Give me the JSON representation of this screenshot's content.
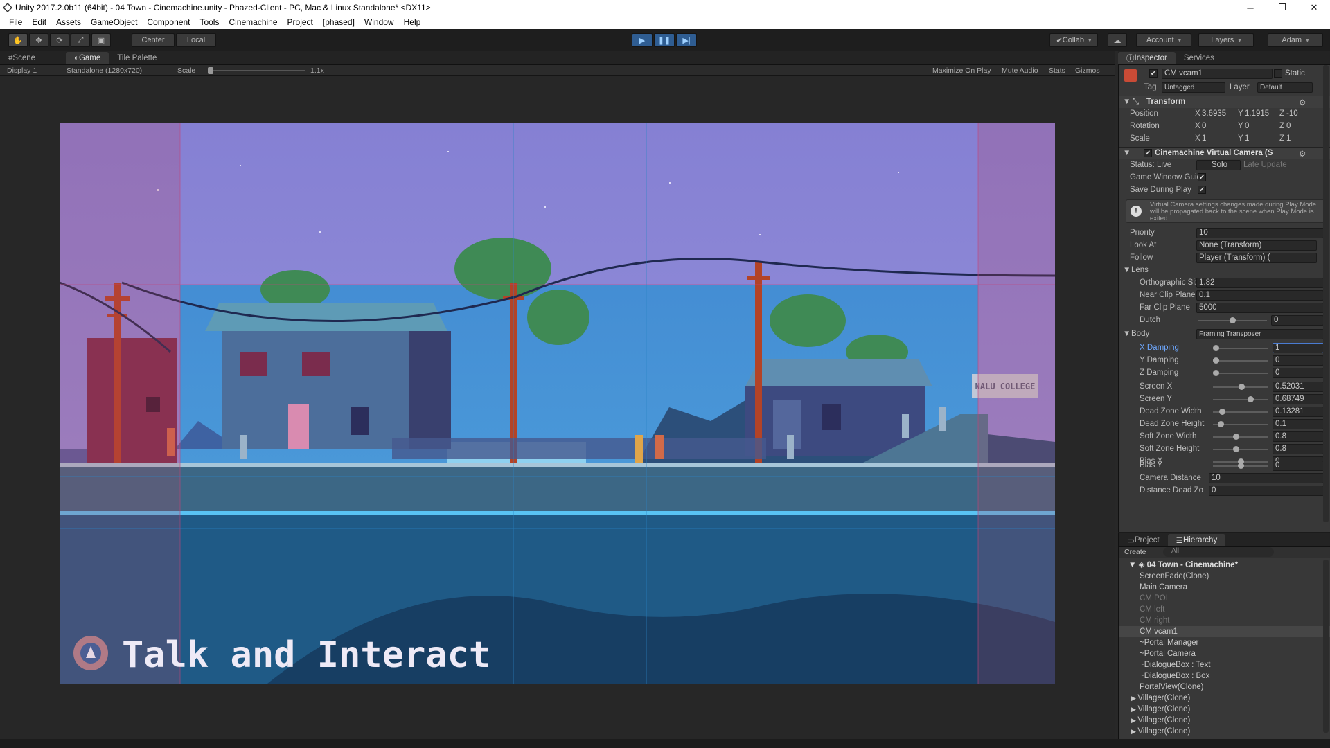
{
  "window": {
    "title": "Unity 2017.2.0b11 (64bit) - 04 Town - Cinemachine.unity - Phazed-Client - PC, Mac & Linux Standalone* <DX11>",
    "controls": [
      "─",
      "❐",
      "✕"
    ]
  },
  "menu": [
    "File",
    "Edit",
    "Assets",
    "GameObject",
    "Component",
    "Tools",
    "Cinemachine",
    "Project",
    "[phased]",
    "Window",
    "Help"
  ],
  "toolbar": {
    "pivot": "Center",
    "space": "Local",
    "collab": "Collab",
    "account": "Account",
    "layers": "Layers",
    "user": "Adam"
  },
  "tabs": {
    "scene": "Scene",
    "game": "Game",
    "tile_palette": "Tile Palette",
    "inspector": "Inspector",
    "services": "Services",
    "project": "Project",
    "hierarchy": "Hierarchy"
  },
  "gamebar": {
    "display": "Display 1",
    "resolution": "Standalone (1280x720)",
    "scale_label": "Scale",
    "scale_value": "1.1x",
    "maximize": "Maximize On Play",
    "mute": "Mute Audio",
    "stats": "Stats",
    "gizmos": "Gizmos"
  },
  "game": {
    "sign": "NALU COLLEGE",
    "overlay_text": "Talk and Interact",
    "colors": {
      "sky": "#8a86d6",
      "water": "#1e5a86",
      "ground": "#3d6f8a"
    }
  },
  "inspector": {
    "object_name": "CM vcam1",
    "static_label": "Static",
    "tag_label": "Tag",
    "tag_value": "Untagged",
    "layer_label": "Layer",
    "layer_value": "Default",
    "transform": {
      "title": "Transform",
      "position": {
        "label": "Position",
        "x": "3.6935",
        "y": "1.1915",
        "z": "-10"
      },
      "rotation": {
        "label": "Rotation",
        "x": "0",
        "y": "0",
        "z": "0"
      },
      "scale": {
        "label": "Scale",
        "x": "1",
        "y": "1",
        "z": "1"
      }
    },
    "vcam": {
      "title": "Cinemachine Virtual Camera (S",
      "status": "Status: Live",
      "solo": "Solo",
      "late_update": "Late Update",
      "game_window_guides": "Game Window Guide",
      "save_during_play": "Save During Play",
      "note": "Virtual Camera settings changes made during Play Mode will be propagated back to the scene when Play Mode is exited.",
      "priority": {
        "label": "Priority",
        "value": "10"
      },
      "look_at": {
        "label": "Look At",
        "value": "None (Transform)"
      },
      "follow": {
        "label": "Follow",
        "value": "Player (Transform) ("
      },
      "lens": "Lens",
      "ortho": {
        "label": "Orthographic Size",
        "value": "1.82"
      },
      "near": {
        "label": "Near Clip Plane",
        "value": "0.1"
      },
      "far": {
        "label": "Far Clip Plane",
        "value": "5000"
      },
      "dutch": {
        "label": "Dutch",
        "value": "0"
      },
      "body": {
        "label": "Body",
        "value": "Framing Transposer"
      },
      "sliders": [
        {
          "label": "X Damping",
          "value": "1",
          "level": 0.0,
          "highlight": true
        },
        {
          "label": "Y Damping",
          "value": "0",
          "level": 0.0
        },
        {
          "label": "Z Damping",
          "value": "0",
          "level": 0.0
        },
        {
          "label": "Screen X",
          "value": "0.52031",
          "level": 0.52
        },
        {
          "label": "Screen Y",
          "value": "0.68749",
          "level": 0.69
        },
        {
          "label": "Dead Zone Width",
          "value": "0.13281",
          "level": 0.13
        },
        {
          "label": "Dead Zone Height",
          "value": "0.1",
          "level": 0.1
        },
        {
          "label": "Soft Zone Width",
          "value": "0.8",
          "level": 0.4
        },
        {
          "label": "Soft Zone Height",
          "value": "0.8",
          "level": 0.4
        },
        {
          "label": "Bias X",
          "value": "0",
          "level": 0.5
        },
        {
          "label": "Bias Y",
          "value": "0",
          "level": 0.5
        }
      ],
      "camera_distance": {
        "label": "Camera Distance",
        "value": "10"
      },
      "distance_dead_zone": {
        "label": "Distance Dead Zo",
        "value": "0"
      }
    }
  },
  "hierarchy": {
    "create": "Create",
    "search": "All",
    "scene": "04 Town - Cinemachine*",
    "items": [
      {
        "name": "ScreenFade(Clone)",
        "dim": false
      },
      {
        "name": "Main Camera",
        "dim": false
      },
      {
        "name": "CM POI",
        "dim": true
      },
      {
        "name": "CM left",
        "dim": true
      },
      {
        "name": "CM right",
        "dim": true
      },
      {
        "name": "CM vcam1",
        "dim": false,
        "selected": true
      },
      {
        "name": "~Portal Manager",
        "dim": false
      },
      {
        "name": "~Portal Camera",
        "dim": false
      },
      {
        "name": "~DialogueBox : Text",
        "dim": false
      },
      {
        "name": "~DialogueBox : Box",
        "dim": false
      },
      {
        "name": "PortalView(Clone)",
        "dim": false
      },
      {
        "name": "Villager(Clone)",
        "dim": false,
        "expand": true
      },
      {
        "name": "Villager(Clone)",
        "dim": false,
        "expand": true
      },
      {
        "name": "Villager(Clone)",
        "dim": false,
        "expand": true
      },
      {
        "name": "Villager(Clone)",
        "dim": false,
        "expand": true
      }
    ]
  }
}
